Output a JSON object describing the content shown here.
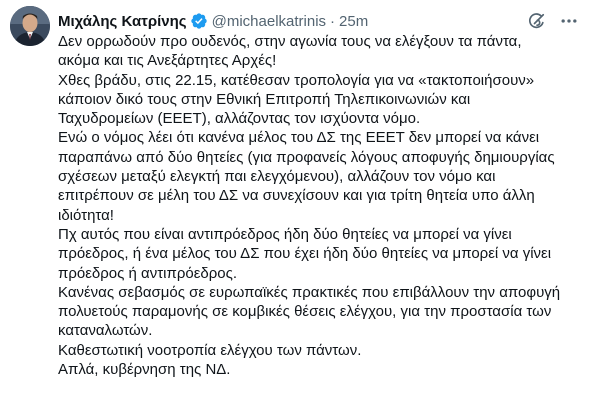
{
  "tweet": {
    "author_name": "Μιχάλης Κατρίνης",
    "handle": "@michaelkatrinis",
    "separator": "·",
    "time": "25m",
    "lines": [
      "Δεν ορρωδούν προ ουδενός, στην αγωνία τους να ελέγξουν τα πάντα,",
      "ακόμα και τις Ανεξάρτητες Αρχές!",
      "Χθες βράδυ, στις 22.15, κατέθεσαν τροπολογία για να «τακτοποιήσουν»",
      "κάποιον δικό τους στην Εθνική Επιτροπή Τηλεπικοινωνιών και",
      "Ταχυδρομείων (ΕΕΕΤ), αλλάζοντας τον ισχύοντα νόμο.",
      "Ενώ ο νόμος λέει ότι κανένα μέλος του ΔΣ της ΕΕΕΤ δεν μπορεί να κάνει",
      "παραπάνω από δύο θητείες (για προφανείς λόγους αποφυγής δημιουργίας",
      "σχέσεων μεταξύ ελεγκτή παι ελεγχόμενου), αλλάζουν τον νόμο και",
      "επιτρέπουν σε μέλη του ΔΣ να συνεχίσουν και για τρίτη θητεία υπο άλλη",
      "ιδιότητα!",
      "Πχ αυτός που είναι αντιπρόεδρος ήδη δύο θητείες να μπορεί να γίνει",
      "πρόεδρος, ή ένα μέλος του ΔΣ που έχει ήδη δύο θητείες να μπορεί να γίνει",
      "πρόεδρος ή αντιπρόεδρος.",
      "Κανένας σεβασμός σε ευρωπαϊκές πρακτικές που επιβάλλουν την αποφυγή",
      "πολυετούς παραμονής σε κομβικές θέσεις ελέγχου, για την προστασία των",
      "καταναλωτών.",
      "Καθεστωτική νοοτροπία ελέγχου των πάντων.",
      "Απλά, κυβέρνηση της ΝΔ."
    ]
  },
  "icons": {
    "verified": "verified-badge-icon",
    "grok": "grok-icon",
    "more": "more-options-icon"
  },
  "colors": {
    "text": "#0f1419",
    "secondary": "#536471",
    "verified": "#1d9bf0"
  }
}
